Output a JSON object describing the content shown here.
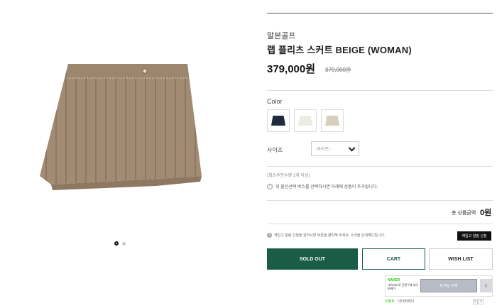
{
  "product": {
    "brand": "말본골프",
    "title": "랩 플리츠 스커트 BEIGE (WOMAN)",
    "price": "379,000원",
    "original_price": "379,000원"
  },
  "gallery": {
    "image_name": "pleated skirt beige",
    "dots": [
      {
        "active": true
      },
      {
        "active": false
      }
    ]
  },
  "color_option": {
    "label": "Color",
    "swatches": [
      {
        "name": "navy",
        "color": "#1f2a3e"
      },
      {
        "name": "white",
        "color": "#eeebe3"
      },
      {
        "name": "beige",
        "color": "#d8cfbe"
      }
    ]
  },
  "size_option": {
    "label": "사이즈",
    "placeholder": "::사이즈::"
  },
  "min_order": "(최소주문수량 1개 이상)",
  "notice": "위 옵션선택 박스를 선택하시면 아래에 상품이 추가됩니다.",
  "total": {
    "label": "총 상품금액",
    "value": "0원"
  },
  "cart_note": "재입고 알림 신청을 원하시면 버튼을 클릭해 주세요. 소식을 안내해드립니다.",
  "restock_button": "재입고 알림 신청",
  "actions": {
    "sold_out": "SOLD OUT",
    "cart": "CART",
    "wish_list": "WISH LIST"
  },
  "naver": {
    "logo": "NAVER",
    "desc": "네이버ID로 간편구매 네이버페이",
    "pay_button": "N Pay 구매",
    "small_button": "찜",
    "event_prefix": "이벤트",
    "event_text": "네이버페이",
    "prev": "<",
    "next": ">"
  },
  "colors": {
    "accent": "#1a5c45",
    "skirt": "#a08a72"
  }
}
